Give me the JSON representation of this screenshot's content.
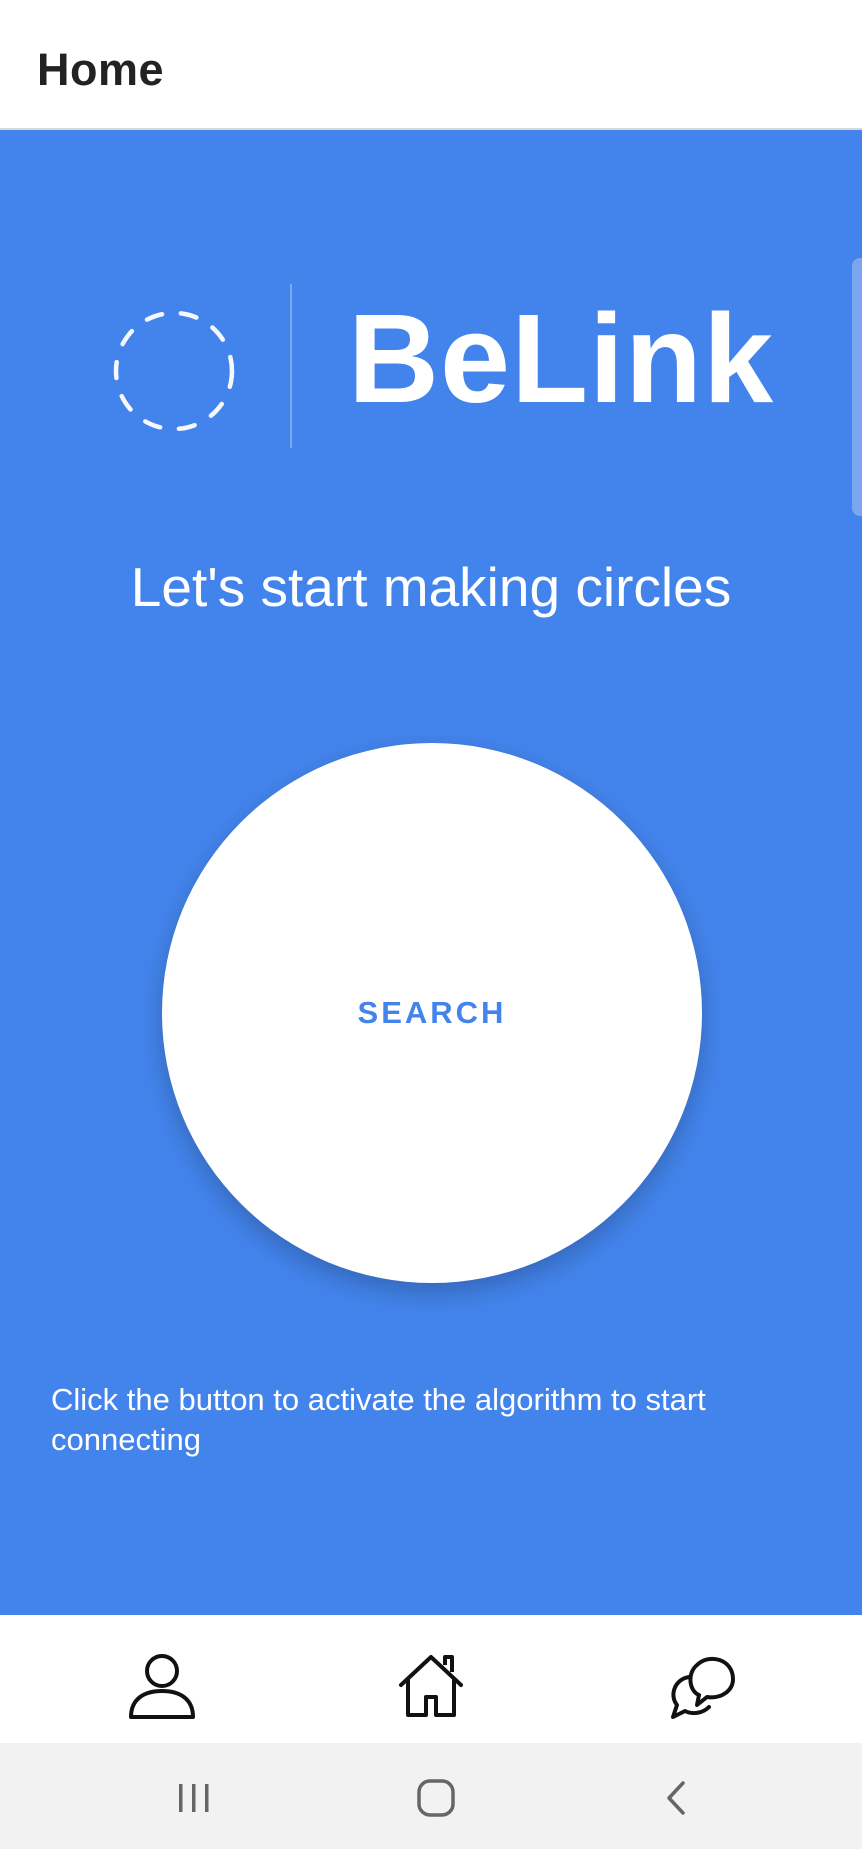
{
  "app_bar": {
    "title": "Home"
  },
  "logo": {
    "wordmark": "BeLink"
  },
  "hero": {
    "tagline": "Let's start making circles",
    "search_label": "SEARCH",
    "instructions": "Click the button to activate the algorithm to start connecting"
  },
  "bottom_nav": {
    "items": [
      {
        "icon": "profile-icon"
      },
      {
        "icon": "home-icon"
      },
      {
        "icon": "chat-icon"
      }
    ]
  },
  "system_nav": {
    "buttons": [
      {
        "icon": "recent-apps-icon"
      },
      {
        "icon": "home-button-icon"
      },
      {
        "icon": "back-icon"
      }
    ]
  },
  "colors": {
    "primary": "#4384ec",
    "surface": "#ffffff",
    "system_bar": "#f2f2f2"
  }
}
